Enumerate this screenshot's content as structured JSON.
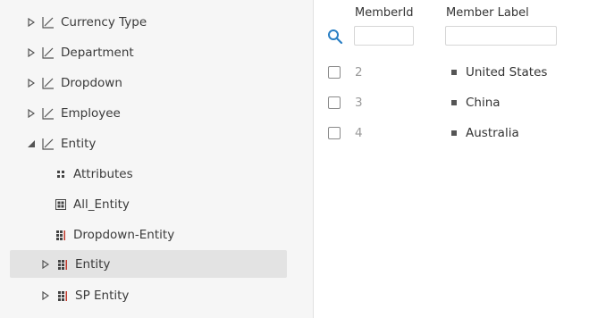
{
  "tree": {
    "items": [
      {
        "label": "Currency Type",
        "icon": "chart-line-icon",
        "expander": "collapsed"
      },
      {
        "label": "Department",
        "icon": "chart-line-icon",
        "expander": "collapsed"
      },
      {
        "label": "Dropdown",
        "icon": "chart-line-icon",
        "expander": "collapsed"
      },
      {
        "label": "Employee",
        "icon": "chart-line-icon",
        "expander": "collapsed"
      },
      {
        "label": "Entity",
        "icon": "chart-line-icon",
        "expander": "expanded"
      }
    ],
    "children": [
      {
        "label": "Attributes",
        "icon": "attributes-dots-icon",
        "expander": "none"
      },
      {
        "label": "All_Entity",
        "icon": "grid-table-icon",
        "expander": "none"
      },
      {
        "label": "Dropdown-Entity",
        "icon": "hierarchy-grid-icon",
        "expander": "none"
      },
      {
        "label": "Entity",
        "icon": "hierarchy-grid-icon",
        "expander": "collapsed",
        "selected": true
      },
      {
        "label": "SP Entity",
        "icon": "hierarchy-grid-icon",
        "expander": "collapsed"
      }
    ]
  },
  "grid": {
    "columns": {
      "member_id": "MemberId",
      "member_label": "Member Label"
    },
    "filters": {
      "member_id": "",
      "member_label": ""
    },
    "rows": [
      {
        "id": "2",
        "label": "United States"
      },
      {
        "id": "3",
        "label": "China"
      },
      {
        "id": "4",
        "label": "Australia"
      }
    ],
    "accent_color": "#2a7fc4"
  }
}
